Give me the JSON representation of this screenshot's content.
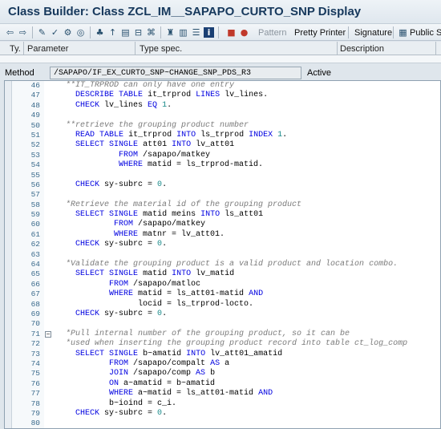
{
  "window": {
    "title": "Class Builder: Class ZCL_IM__SAPAPO_CURTO_SNP Display"
  },
  "toolbar": {
    "pattern_label": "Pattern",
    "pretty_printer_label": "Pretty Printer",
    "signature_label": "Signature",
    "public_section_label": "Public Sec"
  },
  "params": {
    "columns": [
      "Ty.",
      "Parameter",
      "Type spec.",
      "Description"
    ]
  },
  "method": {
    "label": "Method",
    "value": "/SAPAPO/IF_EX_CURTO_SNP~CHANGE_SNP_PDS_R3",
    "status": "Active"
  },
  "code_lines": [
    {
      "n": "46",
      "t": "  **IT_TRPROD can only have one entry"
    },
    {
      "n": "47",
      "t": "    DESCRIBE TABLE it_trprod LINES lv_lines."
    },
    {
      "n": "48",
      "t": "    CHECK lv_lines EQ 1."
    },
    {
      "n": "49",
      "t": ""
    },
    {
      "n": "50",
      "t": "  **retrieve the grouping product number"
    },
    {
      "n": "51",
      "t": "    READ TABLE it_trprod INTO ls_trprod INDEX 1."
    },
    {
      "n": "52",
      "t": "    SELECT SINGLE att01 INTO lv_att01"
    },
    {
      "n": "53",
      "t": "             FROM /sapapo/matkey"
    },
    {
      "n": "54",
      "t": "             WHERE matid = ls_trprod-matid."
    },
    {
      "n": "55",
      "t": ""
    },
    {
      "n": "56",
      "t": "    CHECK sy-subrc = 0."
    },
    {
      "n": "57",
      "t": ""
    },
    {
      "n": "58",
      "t": "  *Retrieve the material id of the grouping product"
    },
    {
      "n": "59",
      "t": "    SELECT SINGLE matid meins INTO ls_att01"
    },
    {
      "n": "60",
      "t": "            FROM /sapapo/matkey"
    },
    {
      "n": "61",
      "t": "            WHERE matnr = lv_att01."
    },
    {
      "n": "62",
      "t": "    CHECK sy-subrc = 0."
    },
    {
      "n": "63",
      "t": ""
    },
    {
      "n": "64",
      "t": "  *Validate the grouping product is a valid product and location combo."
    },
    {
      "n": "65",
      "t": "    SELECT SINGLE matid INTO lv_matid"
    },
    {
      "n": "66",
      "t": "           FROM /sapapo/matloc"
    },
    {
      "n": "67",
      "t": "           WHERE matid = ls_att01-matid AND"
    },
    {
      "n": "68",
      "t": "                 locid = ls_trprod-locto."
    },
    {
      "n": "69",
      "t": "    CHECK sy-subrc = 0."
    },
    {
      "n": "70",
      "t": ""
    },
    {
      "n": "71",
      "t": "  *Pull internal number of the grouping product, so it can be",
      "fold": true
    },
    {
      "n": "72",
      "t": "  *used when inserting the grouping product record into table ct_log_comp"
    },
    {
      "n": "73",
      "t": "    SELECT SINGLE b~amatid INTO lv_att01_amatid"
    },
    {
      "n": "74",
      "t": "           FROM /sapapo/compalt AS a"
    },
    {
      "n": "75",
      "t": "           JOIN /sapapo/comp AS b"
    },
    {
      "n": "76",
      "t": "           ON a~amatid = b~amatid"
    },
    {
      "n": "77",
      "t": "           WHERE a~matid = ls_att01-matid AND"
    },
    {
      "n": "78",
      "t": "           b~ioind = c_i."
    },
    {
      "n": "79",
      "t": "    CHECK sy-subrc = 0."
    },
    {
      "n": "80",
      "t": ""
    }
  ]
}
